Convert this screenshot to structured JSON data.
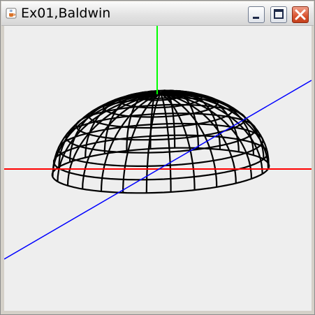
{
  "window": {
    "title": "Ex01,Baldwin",
    "icon": "java-cup-icon",
    "controls": {
      "minimize_icon": "minimize-icon",
      "maximize_icon": "maximize-icon",
      "close_icon": "close-icon"
    }
  },
  "scene": {
    "background_color": "#eeeeee",
    "axes": [
      {
        "name": "x-axis",
        "color": "#ff0000"
      },
      {
        "name": "y-axis",
        "color": "#00ff00"
      },
      {
        "name": "z-axis",
        "color": "#0000ff"
      }
    ],
    "object": {
      "shape": "half-ellipsoid wireframe",
      "color": "#000000"
    }
  }
}
